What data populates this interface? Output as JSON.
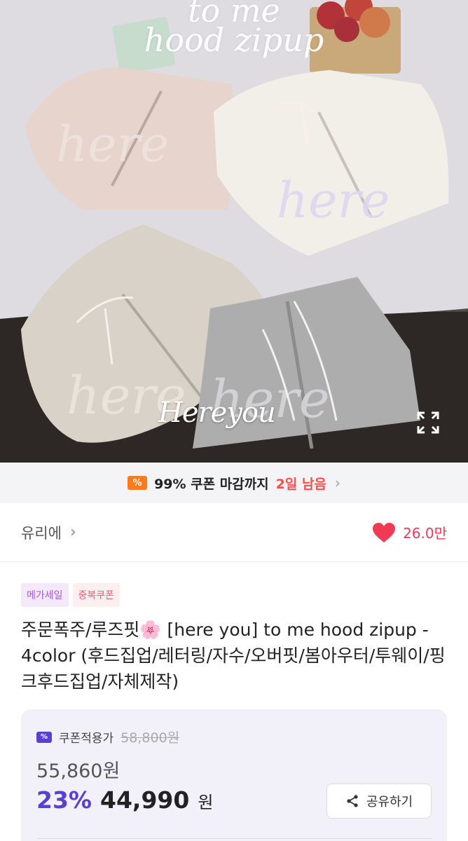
{
  "hero": {
    "title_line1": "to me",
    "title_line2": "hood zipup",
    "watermark": "Hereyou",
    "expand_icon": "expand-icon"
  },
  "coupon_bar": {
    "icon": "coupon-icon",
    "text": "99% 쿠폰 마감까지",
    "remaining": "2일 남음",
    "accent_color": "#ff7a1a",
    "remaining_color": "#ff4d4d"
  },
  "shop": {
    "name": "유리에",
    "likes": "26.0만",
    "like_color": "#ef3b54"
  },
  "badges": [
    {
      "label": "메가세일"
    },
    {
      "label": "중복쿠폰"
    }
  ],
  "product": {
    "title": "주문폭주/루즈핏🌸 [here you] to me hood zipup - 4color (후드집업/레터링/자수/오버핏/봄아우터/투웨이/핑크후드집업/자체제작)"
  },
  "price": {
    "coupon_label": "쿠폰적용가",
    "original": "58,800원",
    "sale": "55,860원",
    "discount_rate": "23%",
    "final_amount": "44,990",
    "currency": "원",
    "accent_color": "#5b3fd1"
  },
  "share": {
    "label": "공유하기",
    "icon": "share-icon"
  }
}
